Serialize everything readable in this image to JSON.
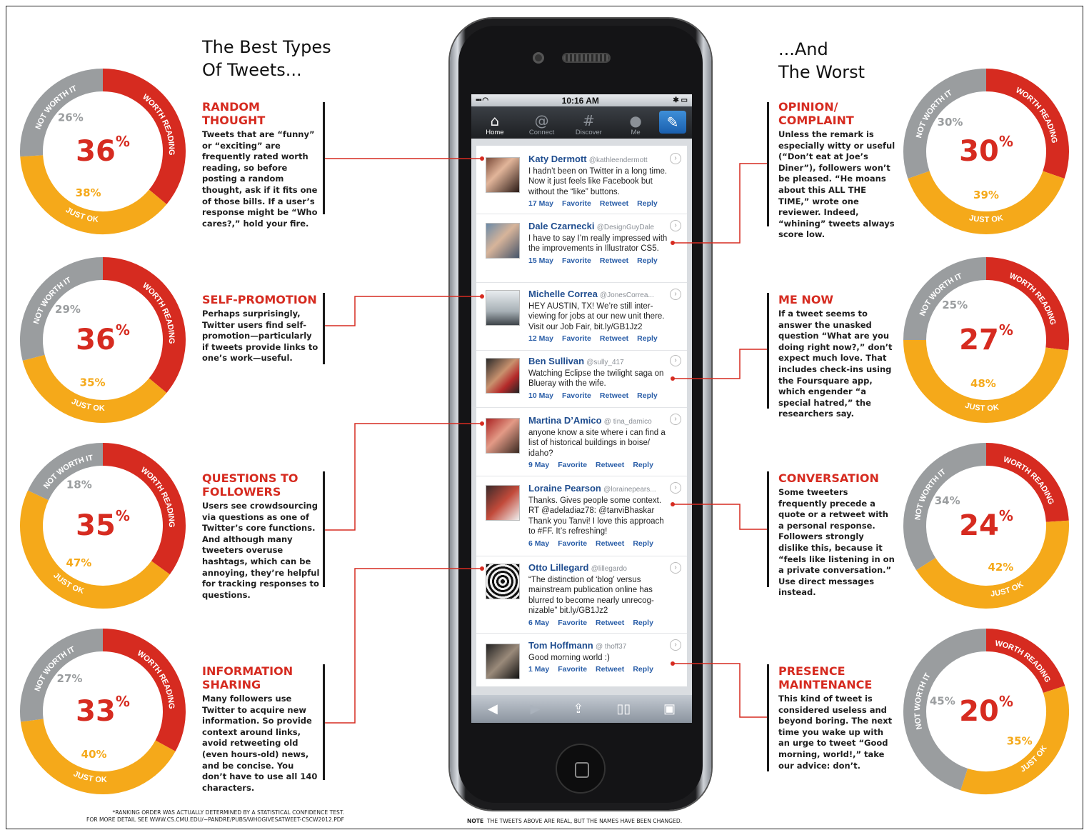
{
  "headings": {
    "best": [
      "The Best Types",
      "Of Tweets..."
    ],
    "worst": [
      "...And",
      "The Worst"
    ]
  },
  "colors": {
    "worth_reading": "#d62b20",
    "just_ok": "#f5a91a",
    "not_worth_it": "#9a9d9f",
    "accent_text": "#d62b20"
  },
  "ring_labels": {
    "worth": "WORTH READING",
    "ok": "JUST OK",
    "not": "NOT WORTH IT"
  },
  "best": [
    {
      "title": "RANDOM THOUGHT",
      "body": "Tweets that are “funny” or “exciting” are frequently rated worth reading, so before posting a random thought, ask if it fits one of those bills. If a user’s response might be “Who cares?,” hold your fire.",
      "worth": "36",
      "ok": "38%",
      "not": "26%"
    },
    {
      "title": "SELF-PROMOTION",
      "body": "Perhaps surprisingly, Twitter users find self-promotion—particularly if tweets provide links to one’s work—useful.",
      "worth": "36",
      "ok": "35%",
      "not": "29%"
    },
    {
      "title": "QUESTIONS TO FOLLOWERS",
      "body": "Users see crowdsourcing via questions as one of Twitter’s core functions. And although many tweeters overuse hashtags, which can be annoying, they’re helpful for tracking responses to questions.",
      "worth": "35",
      "ok": "47%",
      "not": "18%"
    },
    {
      "title": "INFORMATION SHARING",
      "body": "Many followers use Twitter to acquire new information. So provide context around links, avoid retweeting old (even hours-old) news, and be concise. You don’t have to use all 140 characters.",
      "worth": "33",
      "ok": "40%",
      "not": "27%"
    }
  ],
  "worst": [
    {
      "title": "OPINION/ COMPLAINT",
      "body": "Unless the remark is especially witty or useful (“Don’t eat at Joe’s Diner”), followers won’t be pleased. “He moans about this ALL THE TIME,” wrote one reviewer. Indeed, “whining” tweets always score low.",
      "worth": "30",
      "ok": "39%",
      "not": "30%"
    },
    {
      "title": "ME NOW",
      "body": "If a tweet seems to answer the unasked question “What are you doing right now?,” don’t expect much love. That includes check-ins using the Foursquare app, which engender “a special hatred,” the researchers say.",
      "worth": "27",
      "ok": "48%",
      "not": "25%"
    },
    {
      "title": "CONVERSATION",
      "body": "Some tweeters frequently precede a quote or a retweet with a personal response. Followers strongly dislike this, because it “feels like listening in on a private conversation.” Use direct messages instead.",
      "worth": "24",
      "ok": "42%",
      "not": "34%"
    },
    {
      "title": "PRESENCE MAINTENANCE",
      "body": "This kind of tweet is considered useless and beyond boring. The next time you wake up with an urge to tweet “Good morning, world!,” take our advice: don’t.",
      "worth": "20",
      "ok": "35%",
      "not": "45%"
    }
  ],
  "phone": {
    "time": "10:16 AM",
    "tabs": [
      {
        "label": "Home",
        "icon": "home-icon"
      },
      {
        "label": "Connect",
        "icon": "at-icon"
      },
      {
        "label": "Discover",
        "icon": "hash-icon"
      },
      {
        "label": "Me",
        "icon": "person-icon"
      }
    ],
    "actions": {
      "favorite": "Favorite",
      "retweet": "Retweet",
      "reply": "Reply"
    },
    "tweets": [
      {
        "name": "Katy Dermott",
        "handle": "@kathleendermott",
        "text": "I hadn’t been on Twitter in a long time. Now it just feels like Facebook but without the “like” buttons.",
        "date": "17 May"
      },
      {
        "name": "Dale Czarnecki",
        "handle": "@DesignGuyDale",
        "text": "I have to say I’m really impressed with the improvements in Illustrator CS5.",
        "date": "15 May"
      },
      {
        "name": "Michelle Correa",
        "handle": "@JonesCorrea...",
        "text": "HEY AUSTIN, TX! We’re still inter-viewing for jobs at our new unit there. Visit our Job Fair, bit.ly/GB1Jz2",
        "date": "12 May"
      },
      {
        "name": "Ben Sullivan",
        "handle": "@sully_417",
        "text": "Watching Eclipse the twilight saga on Blueray with the wife.",
        "date": "10 May"
      },
      {
        "name": "Martina D’Amico",
        "handle": "@ tina_damico",
        "text": "anyone know a site where i can find a list of historical buildings in boise/ idaho?",
        "date": "9 May"
      },
      {
        "name": "Loraine Pearson",
        "handle": "@lorainepears...",
        "text": "Thanks. Gives people some context. RT @adeladiaz78: @tanviBhaskar Thank you Tanvi! I love this approach to #FF. It’s refreshing!",
        "date": "6 May"
      },
      {
        "name": "Otto Lillegard",
        "handle": "@lillegardo",
        "text": "“The distinction of ‘blog’ versus mainstream publication online has blurred to become nearly unrecog-nizable” bit.ly/GB1Jz2",
        "date": "6 May"
      },
      {
        "name": "Tom Hoffmann",
        "handle": "@ thoff37",
        "text": "Good morning world :)",
        "date": "1 May"
      }
    ]
  },
  "footnotes": {
    "left_line1": "*RANKING ORDER WAS ACTUALLY DETERMINED BY A STATISTICAL CONFIDENCE TEST.",
    "left_line2": "FOR MORE DETAIL SEE WWW.CS.CMU.EDU/~PANDRE/PUBS/WHOGIVESATWEET-CSCW2012.PDF",
    "note_label": "NOTE",
    "note_text": "THE TWEETS ABOVE ARE REAL, BUT THE NAMES HAVE BEEN CHANGED."
  },
  "chart_data": [
    {
      "type": "pie",
      "title": "RANDOM THOUGHT",
      "categories": [
        "WORTH READING",
        "JUST OK",
        "NOT WORTH IT"
      ],
      "values": [
        36,
        38,
        26
      ]
    },
    {
      "type": "pie",
      "title": "SELF-PROMOTION",
      "categories": [
        "WORTH READING",
        "JUST OK",
        "NOT WORTH IT"
      ],
      "values": [
        36,
        35,
        29
      ]
    },
    {
      "type": "pie",
      "title": "QUESTIONS TO FOLLOWERS",
      "categories": [
        "WORTH READING",
        "JUST OK",
        "NOT WORTH IT"
      ],
      "values": [
        35,
        47,
        18
      ]
    },
    {
      "type": "pie",
      "title": "INFORMATION SHARING",
      "categories": [
        "WORTH READING",
        "JUST OK",
        "NOT WORTH IT"
      ],
      "values": [
        33,
        40,
        27
      ]
    },
    {
      "type": "pie",
      "title": "OPINION/ COMPLAINT",
      "categories": [
        "WORTH READING",
        "JUST OK",
        "NOT WORTH IT"
      ],
      "values": [
        30,
        39,
        30
      ]
    },
    {
      "type": "pie",
      "title": "ME NOW",
      "categories": [
        "WORTH READING",
        "JUST OK",
        "NOT WORTH IT"
      ],
      "values": [
        27,
        48,
        25
      ]
    },
    {
      "type": "pie",
      "title": "CONVERSATION",
      "categories": [
        "WORTH READING",
        "JUST OK",
        "NOT WORTH IT"
      ],
      "values": [
        24,
        42,
        34
      ]
    },
    {
      "type": "pie",
      "title": "PRESENCE MAINTENANCE",
      "categories": [
        "WORTH READING",
        "JUST OK",
        "NOT WORTH IT"
      ],
      "values": [
        20,
        35,
        45
      ]
    }
  ]
}
